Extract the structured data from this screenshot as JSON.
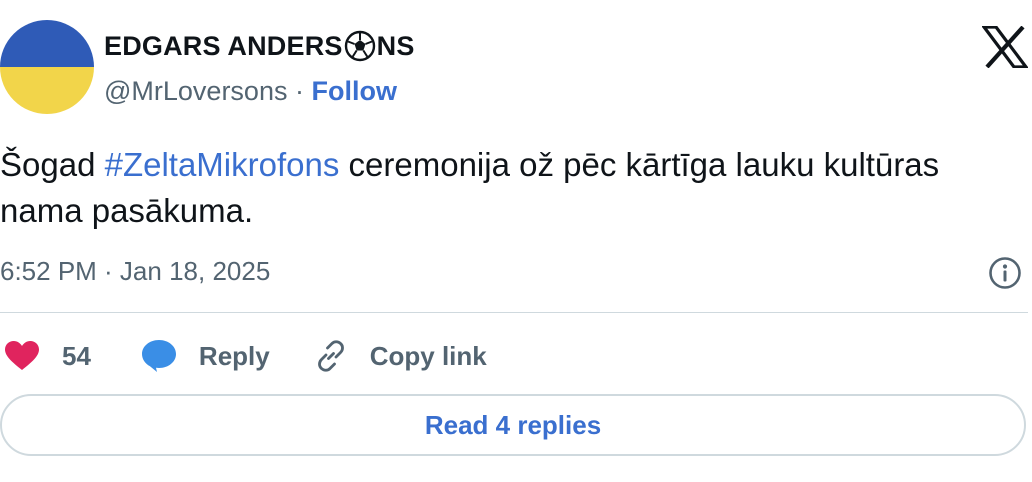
{
  "author": {
    "name_prefix": "EDGARS ANDERS",
    "name_suffix": "NS",
    "name_emoji": "soccer-ball-icon",
    "handle": "@MrLoversons",
    "separator": "·",
    "follow_label": "Follow",
    "avatar_colors": {
      "top": "#2f5bb7",
      "bottom": "#f2d54a"
    }
  },
  "tweet": {
    "text_before": "Šogad ",
    "hashtag": "#ZeltaMikrofons",
    "text_after": " ceremonija ož pēc kārtīga lauku kultūras nama pasākuma.",
    "timestamp": "6:52 PM · Jan 18, 2025"
  },
  "actions": {
    "like_count": "54",
    "reply_label": "Reply",
    "copy_label": "Copy link"
  },
  "read_replies_label": "Read 4 replies",
  "colors": {
    "accent": "#3a6fcf",
    "like": "#e0245e",
    "muted": "#536471"
  },
  "icons": [
    "x-logo-icon",
    "info-icon",
    "heart-icon",
    "speech-bubble-icon",
    "link-icon"
  ]
}
